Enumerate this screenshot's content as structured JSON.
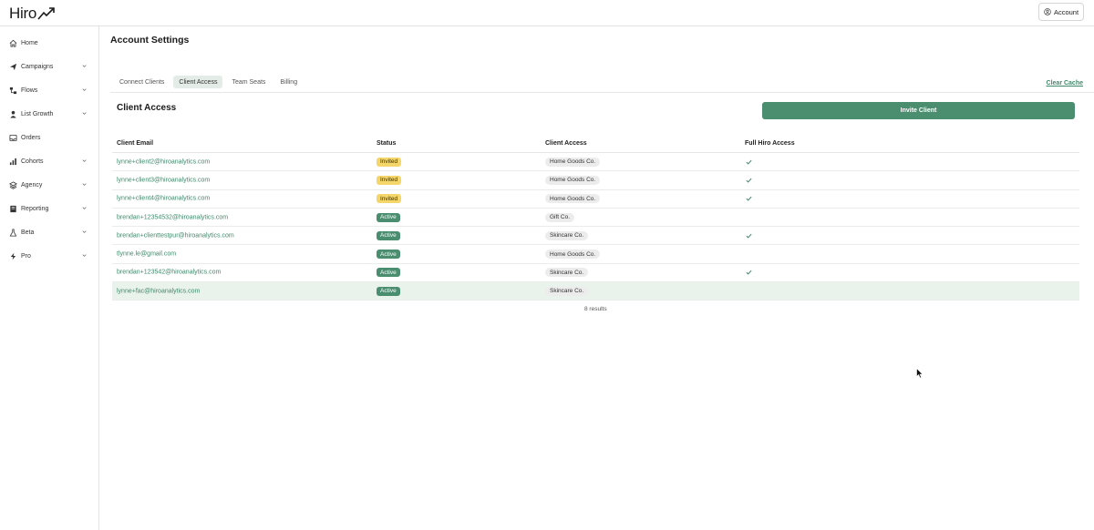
{
  "app": {
    "logo": "Hiro",
    "account_label": "Account"
  },
  "sidebar": {
    "items": [
      {
        "label": "Home",
        "icon": "home-icon",
        "has_chevron": false
      },
      {
        "label": "Campaigns",
        "icon": "paper-plane-icon",
        "has_chevron": true
      },
      {
        "label": "Flows",
        "icon": "flow-icon",
        "has_chevron": true
      },
      {
        "label": "List Growth",
        "icon": "user-icon",
        "has_chevron": true
      },
      {
        "label": "Orders",
        "icon": "inbox-icon",
        "has_chevron": false
      },
      {
        "label": "Cohorts",
        "icon": "bar-chart-icon",
        "has_chevron": true
      },
      {
        "label": "Agency",
        "icon": "layers-icon",
        "has_chevron": true
      },
      {
        "label": "Reporting",
        "icon": "report-icon",
        "has_chevron": true
      },
      {
        "label": "Beta",
        "icon": "flask-icon",
        "has_chevron": true
      },
      {
        "label": "Pro",
        "icon": "bolt-icon",
        "has_chevron": true
      }
    ]
  },
  "page": {
    "title": "Account Settings",
    "tabs": [
      {
        "label": "Connect Clients",
        "active": false
      },
      {
        "label": "Client Access",
        "active": true
      },
      {
        "label": "Team Seats",
        "active": false
      },
      {
        "label": "Billing",
        "active": false
      }
    ],
    "clear_cache_label": "Clear Cache",
    "section_title": "Client Access",
    "invite_label": "Invite Client"
  },
  "table": {
    "headers": {
      "email": "Client Email",
      "status": "Status",
      "access": "Client Access",
      "full": "Full Hiro Access"
    },
    "rows": [
      {
        "email": "lynne+client2@hiroanalytics.com",
        "status": "Invited",
        "access": "Home Goods Co.",
        "full_access": true
      },
      {
        "email": "lynne+client3@hiroanalytics.com",
        "status": "Invited",
        "access": "Home Goods Co.",
        "full_access": true
      },
      {
        "email": "lynne+client4@hiroanalytics.com",
        "status": "Invited",
        "access": "Home Goods Co.",
        "full_access": true
      },
      {
        "email": "brendan+12354532@hiroanalytics.com",
        "status": "Active",
        "access": "Gift Co.",
        "full_access": false
      },
      {
        "email": "brendan+clienttestpur@hiroanalytics.com",
        "status": "Active",
        "access": "Skincare Co.",
        "full_access": true
      },
      {
        "email": "tlynne.le@gmail.com",
        "status": "Active",
        "access": "Home Goods Co.",
        "full_access": false
      },
      {
        "email": "brendan+123542@hiroanalytics.com",
        "status": "Active",
        "access": "Skincare Co.",
        "full_access": true
      },
      {
        "email": "lynne+fac@hiroanalytics.com",
        "status": "Active",
        "access": "Skincare Co.",
        "full_access": false
      }
    ],
    "results_label": "8 results"
  },
  "colors": {
    "accent": "#4a8d6f",
    "invited": "#f5d66b",
    "link": "#3f8a6a"
  }
}
